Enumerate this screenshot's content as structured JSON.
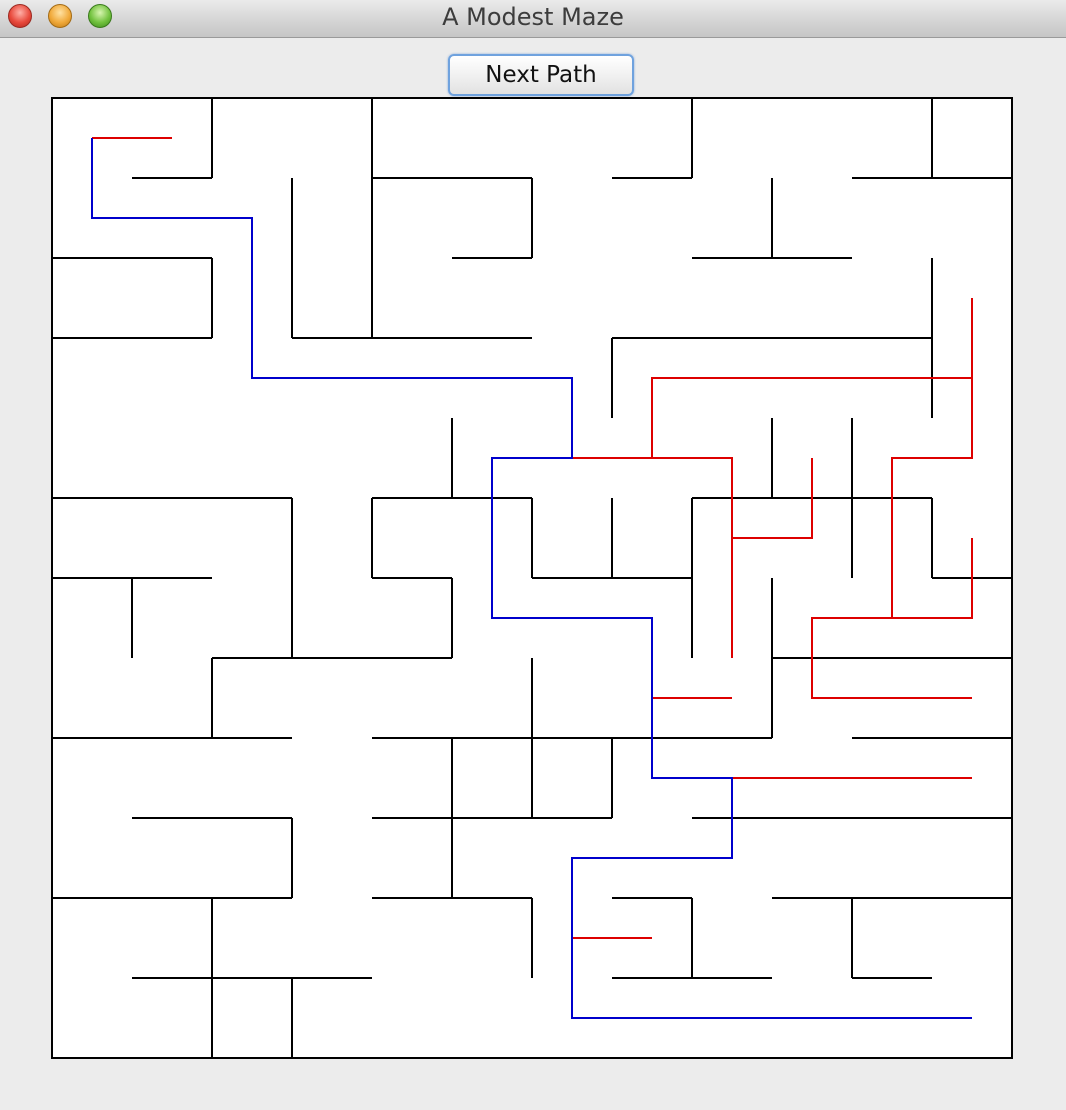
{
  "window": {
    "title": "A Modest Maze",
    "buttons": [
      "close",
      "minimize",
      "zoom"
    ]
  },
  "toolbar": {
    "next_path_label": "Next Path"
  },
  "maze": {
    "rows": 12,
    "cols": 12,
    "wall_color": "#000000",
    "solution_color": "#0000cc",
    "dead_end_color": "#dd0000",
    "hwalls": [
      [
        1,
        1
      ],
      [
        1,
        4
      ],
      [
        1,
        5
      ],
      [
        1,
        7
      ],
      [
        1,
        10
      ],
      [
        1,
        11
      ],
      [
        2,
        0
      ],
      [
        2,
        1
      ],
      [
        2,
        5
      ],
      [
        2,
        8
      ],
      [
        2,
        9
      ],
      [
        3,
        0
      ],
      [
        3,
        1
      ],
      [
        3,
        3
      ],
      [
        3,
        4
      ],
      [
        3,
        5
      ],
      [
        3,
        7
      ],
      [
        3,
        8
      ],
      [
        3,
        9
      ],
      [
        3,
        10
      ],
      [
        5,
        0
      ],
      [
        5,
        1
      ],
      [
        5,
        2
      ],
      [
        5,
        4
      ],
      [
        5,
        5
      ],
      [
        5,
        8
      ],
      [
        5,
        9
      ],
      [
        5,
        10
      ],
      [
        6,
        0
      ],
      [
        6,
        1
      ],
      [
        6,
        4
      ],
      [
        6,
        6
      ],
      [
        6,
        7
      ],
      [
        6,
        11
      ],
      [
        7,
        2
      ],
      [
        7,
        3
      ],
      [
        7,
        4
      ],
      [
        7,
        9
      ],
      [
        7,
        10
      ],
      [
        7,
        11
      ],
      [
        8,
        0
      ],
      [
        8,
        1
      ],
      [
        8,
        2
      ],
      [
        8,
        4
      ],
      [
        8,
        5
      ],
      [
        8,
        6
      ],
      [
        8,
        7
      ],
      [
        8,
        8
      ],
      [
        8,
        10
      ],
      [
        8,
        11
      ],
      [
        9,
        1
      ],
      [
        9,
        2
      ],
      [
        9,
        4
      ],
      [
        9,
        5
      ],
      [
        9,
        6
      ],
      [
        9,
        8
      ],
      [
        9,
        9
      ],
      [
        9,
        10
      ],
      [
        9,
        11
      ],
      [
        10,
        0
      ],
      [
        10,
        1
      ],
      [
        10,
        2
      ],
      [
        10,
        4
      ],
      [
        10,
        5
      ],
      [
        10,
        7
      ],
      [
        10,
        9
      ],
      [
        10,
        10
      ],
      [
        10,
        11
      ],
      [
        11,
        1
      ],
      [
        11,
        2
      ],
      [
        11,
        3
      ],
      [
        11,
        7
      ],
      [
        11,
        8
      ],
      [
        11,
        10
      ],
      [
        12,
        0
      ],
      [
        12,
        3
      ],
      [
        12,
        4
      ],
      [
        12,
        5
      ],
      [
        12,
        7
      ],
      [
        12,
        8
      ],
      [
        12,
        10
      ],
      [
        12,
        11
      ]
    ],
    "vwalls": [
      [
        0,
        2
      ],
      [
        0,
        4
      ],
      [
        0,
        8
      ],
      [
        0,
        11
      ],
      [
        1,
        3
      ],
      [
        1,
        4
      ],
      [
        1,
        6
      ],
      [
        1,
        9
      ],
      [
        2,
        2
      ],
      [
        2,
        3
      ],
      [
        2,
        4
      ],
      [
        2,
        11
      ],
      [
        3,
        7
      ],
      [
        3,
        11
      ],
      [
        4,
        5
      ],
      [
        4,
        9
      ],
      [
        4,
        10
      ],
      [
        5,
        3
      ],
      [
        5,
        4
      ],
      [
        5,
        6
      ],
      [
        5,
        7
      ],
      [
        5,
        8
      ],
      [
        5,
        10
      ],
      [
        5,
        11
      ],
      [
        6,
        1
      ],
      [
        6,
        3
      ],
      [
        6,
        5
      ],
      [
        6,
        8
      ],
      [
        6,
        9
      ],
      [
        7,
        2
      ],
      [
        7,
        6
      ],
      [
        7,
        9
      ],
      [
        8,
        5
      ],
      [
        8,
        6
      ],
      [
        8,
        7
      ],
      [
        9,
        3
      ],
      [
        9,
        5
      ],
      [
        10,
        2
      ],
      [
        10,
        6
      ],
      [
        10,
        8
      ],
      [
        10,
        10
      ],
      [
        11,
        2
      ],
      [
        11,
        3
      ]
    ],
    "solution_path": [
      [
        0.5,
        0.5
      ],
      [
        0.5,
        1.5
      ],
      [
        2.5,
        1.5
      ],
      [
        2.5,
        3.5
      ],
      [
        6.5,
        3.5
      ],
      [
        6.5,
        4.5
      ],
      [
        5.5,
        4.5
      ],
      [
        5.5,
        6.5
      ],
      [
        7.5,
        6.5
      ],
      [
        7.5,
        8.5
      ],
      [
        8.5,
        8.5
      ],
      [
        8.5,
        9.5
      ],
      [
        6.5,
        9.5
      ],
      [
        6.5,
        11.5
      ],
      [
        11.5,
        11.5
      ]
    ],
    "dead_ends": [
      [
        [
          0.5,
          0.5
        ],
        [
          1.5,
          0.5
        ]
      ],
      [
        [
          6.5,
          4.5
        ],
        [
          8.5,
          4.5
        ],
        [
          8.5,
          7.0
        ]
      ],
      [
        [
          7.5,
          4.5
        ],
        [
          7.5,
          3.5
        ],
        [
          11.5,
          3.5
        ]
      ],
      [
        [
          11.5,
          2.5
        ],
        [
          11.5,
          4.5
        ],
        [
          10.5,
          4.5
        ],
        [
          10.5,
          6.5
        ]
      ],
      [
        [
          8.5,
          5.5
        ],
        [
          9.5,
          5.5
        ],
        [
          9.5,
          4.5
        ]
      ],
      [
        [
          11.5,
          5.5
        ],
        [
          11.5,
          6.5
        ],
        [
          9.5,
          6.5
        ],
        [
          9.5,
          7.5
        ],
        [
          11.5,
          7.5
        ]
      ],
      [
        [
          7.5,
          7.5
        ],
        [
          8.5,
          7.5
        ]
      ],
      [
        [
          8.5,
          8.5
        ],
        [
          11.5,
          8.5
        ]
      ],
      [
        [
          6.5,
          10.5
        ],
        [
          7.5,
          10.5
        ]
      ]
    ]
  }
}
